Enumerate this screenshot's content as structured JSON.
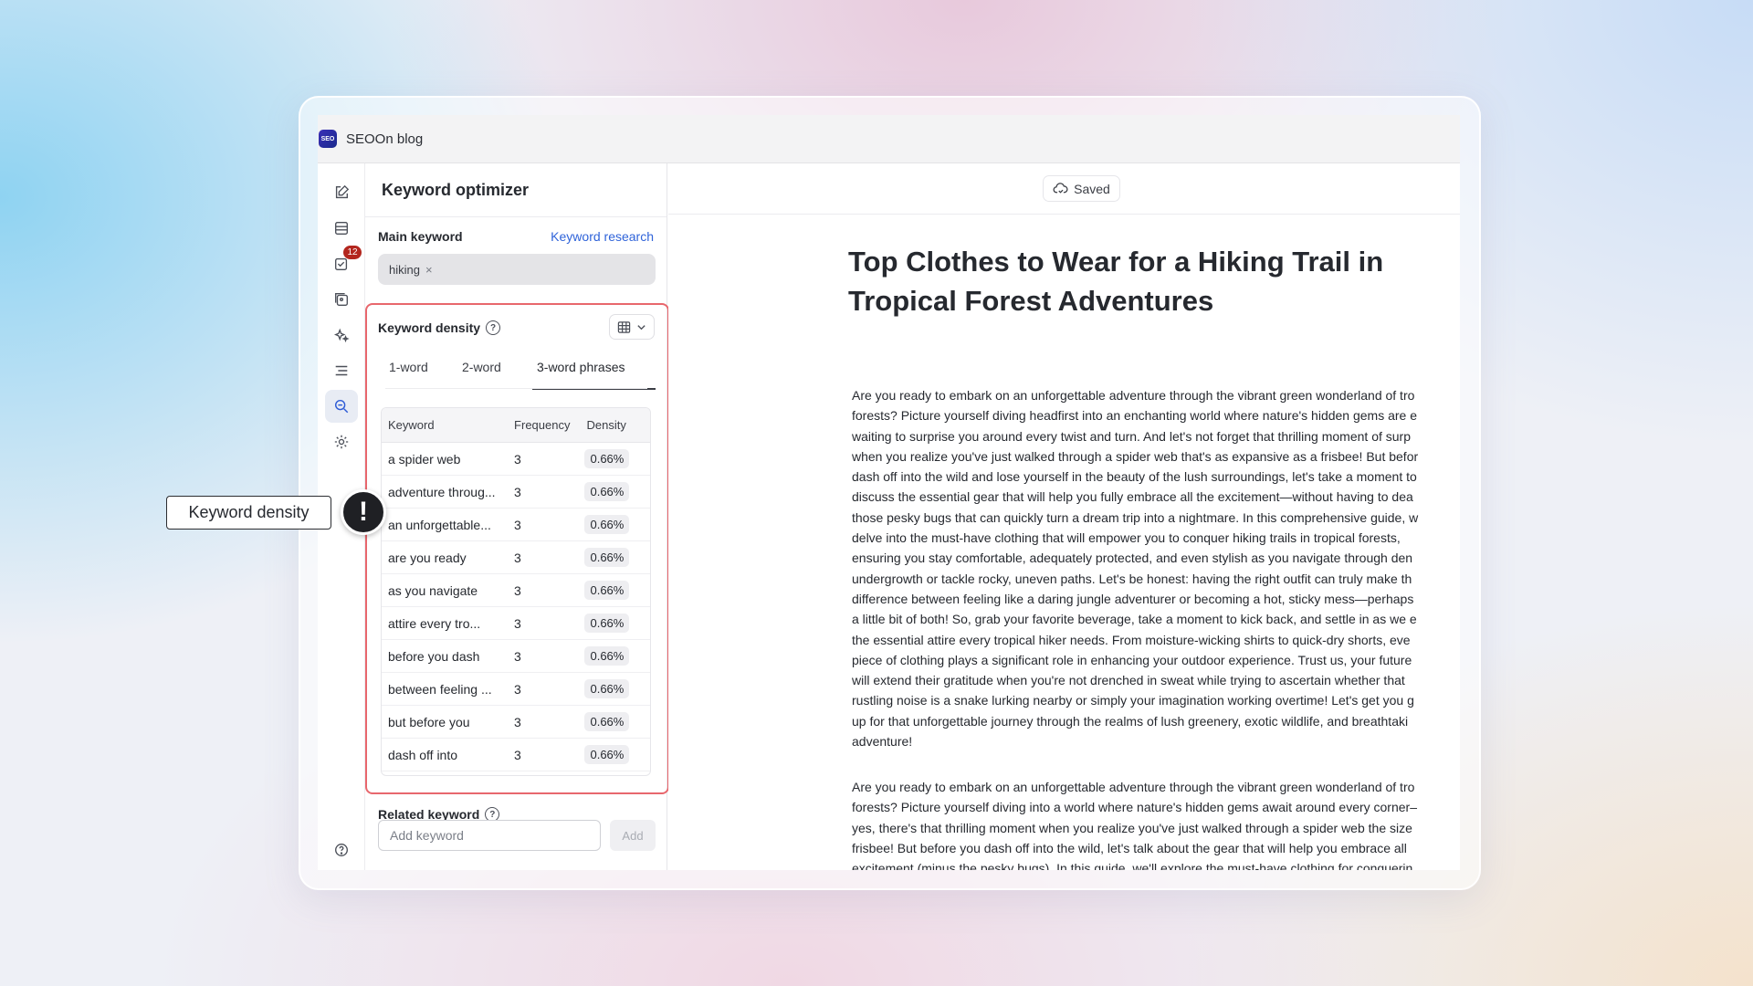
{
  "window": {
    "title": "SEOOn blog",
    "logo_text": "SEO"
  },
  "rail": {
    "badge_count": "12"
  },
  "panel": {
    "title": "Keyword optimizer",
    "main_keyword_label": "Main keyword",
    "keyword_research_link": "Keyword research",
    "main_keyword_chip": "hiking",
    "chip_remove": "×",
    "density_label": "Keyword density",
    "help": "?",
    "tabs": [
      "1-word",
      "2-word",
      "3-word phrases"
    ],
    "columns": [
      "Keyword",
      "Frequency",
      "Density"
    ],
    "rows": [
      {
        "keyword": "a spider web",
        "frequency": "3",
        "density": "0.66%"
      },
      {
        "keyword": "adventure throug...",
        "frequency": "3",
        "density": "0.66%"
      },
      {
        "keyword": "an unforgettable...",
        "frequency": "3",
        "density": "0.66%"
      },
      {
        "keyword": "are you ready",
        "frequency": "3",
        "density": "0.66%"
      },
      {
        "keyword": "as you navigate",
        "frequency": "3",
        "density": "0.66%"
      },
      {
        "keyword": "attire every tro...",
        "frequency": "3",
        "density": "0.66%"
      },
      {
        "keyword": "before you dash",
        "frequency": "3",
        "density": "0.66%"
      },
      {
        "keyword": "between feeling ...",
        "frequency": "3",
        "density": "0.66%"
      },
      {
        "keyword": "but before you",
        "frequency": "3",
        "density": "0.66%"
      },
      {
        "keyword": "dash off into",
        "frequency": "3",
        "density": "0.66%"
      }
    ],
    "related_keyword_label": "Related keyword",
    "add_keyword_placeholder": "Add keyword",
    "add_button": "Add"
  },
  "editor": {
    "saved_label": "Saved",
    "title_line1": "Top Clothes to Wear for a Hiking Trail in",
    "title_line2": "Tropical Forest Adventures",
    "paragraph1": [
      "Are you ready to embark on an unforgettable adventure through the vibrant green wonderland of tro",
      "forests? Picture yourself diving headfirst into an enchanting world where nature's hidden gems are e",
      "waiting to surprise you around every twist and turn. And let's not forget that thrilling moment of surp",
      "when you realize you've just walked through a spider web that's as expansive as a frisbee! But befor",
      "dash off into the wild and lose yourself in the beauty of the lush surroundings, let's take a moment to",
      "discuss the essential gear that will help you fully embrace all the excitement—without having to dea",
      "those pesky bugs that can quickly turn a dream trip into a nightmare. In this comprehensive guide, w",
      "delve into the must-have clothing that will empower you to conquer hiking trails in tropical forests,",
      "ensuring you stay comfortable, adequately protected, and even stylish as you navigate through den",
      "undergrowth or tackle rocky, uneven paths. Let's be honest: having the right outfit can truly make th",
      "difference between feeling like a daring jungle adventurer or becoming a hot, sticky mess—perhaps",
      "a little bit of both! So, grab your favorite beverage, take a moment to kick back, and settle in as we e",
      "the essential attire every tropical hiker needs. From moisture-wicking shirts to quick-dry shorts, eve",
      "piece of clothing plays a significant role in enhancing your outdoor experience. Trust us, your future",
      "will extend their gratitude when you're not drenched in sweat while trying to ascertain whether that",
      "rustling noise is a snake lurking nearby or simply your imagination working overtime! Let's get you g",
      "up for that unforgettable journey through the realms of lush greenery, exotic wildlife, and breathtaki",
      "adventure!"
    ],
    "paragraph2": [
      "Are you ready to embark on an unforgettable adventure through the vibrant green wonderland of tro",
      "forests? Picture yourself diving into a world where nature's hidden gems await around every corner–",
      "yes, there's that thrilling moment when you realize you've just walked through a spider web the size",
      "frisbee! But before you dash off into the wild, let's talk about the gear that will help you embrace all",
      "excitement (minus the pesky bugs). In this guide, we'll explore the must-have clothing for conquerin"
    ]
  },
  "callout": {
    "label": "Keyword density",
    "icon": "!"
  },
  "colors": {
    "highlight_border": "#e8676d",
    "link": "#2f63d9",
    "badge": "#b3261e"
  }
}
